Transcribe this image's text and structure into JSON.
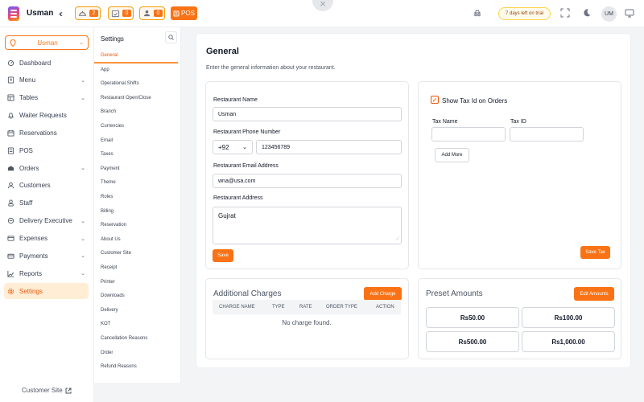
{
  "topbar": {
    "brand": "Usman",
    "chips": [
      {
        "icon": "food-tray-icon",
        "count": "2"
      },
      {
        "icon": "calendar-check-icon",
        "count": "0"
      },
      {
        "icon": "waiter-icon",
        "count": "0"
      }
    ],
    "pos_label": "POS",
    "trial_text": "7 days left on trial",
    "avatar_initials": "UM"
  },
  "sidebar": {
    "branch": "Usman",
    "items": [
      {
        "label": "Dashboard",
        "icon": "dashboard-icon",
        "chevron": false
      },
      {
        "label": "Menu",
        "icon": "menu-book-icon",
        "chevron": true
      },
      {
        "label": "Tables",
        "icon": "table-icon",
        "chevron": true
      },
      {
        "label": "Waiter Requests",
        "icon": "bell-icon",
        "chevron": false
      },
      {
        "label": "Reservations",
        "icon": "calendar-icon",
        "chevron": false
      },
      {
        "label": "POS",
        "icon": "pos-icon",
        "chevron": false
      },
      {
        "label": "Orders",
        "icon": "orders-icon",
        "chevron": true
      },
      {
        "label": "Customers",
        "icon": "customers-icon",
        "chevron": false
      },
      {
        "label": "Staff",
        "icon": "staff-icon",
        "chevron": false
      },
      {
        "label": "Delivery Executive",
        "icon": "delivery-icon",
        "chevron": true
      },
      {
        "label": "Expenses",
        "icon": "expenses-icon",
        "chevron": true
      },
      {
        "label": "Payments",
        "icon": "payments-icon",
        "chevron": true
      },
      {
        "label": "Reports",
        "icon": "reports-icon",
        "chevron": true
      },
      {
        "label": "Settings",
        "icon": "gear-icon",
        "chevron": false,
        "active": true
      }
    ],
    "customer_site": "Customer Site"
  },
  "settings_nav": {
    "title": "Settings",
    "items": [
      "General",
      "App",
      "Operational Shifts",
      "Restaurant Open/Close",
      "Branch",
      "Currencies",
      "Email",
      "Taxes",
      "Payment",
      "Theme",
      "Roles",
      "Billing",
      "Reservation",
      "About Us",
      "Customer Site",
      "Receipt",
      "Printer",
      "Downloads",
      "Delivery",
      "KOT",
      "Cancellation Reasons",
      "Order",
      "Refund Reasons"
    ],
    "active_index": 0
  },
  "general": {
    "title": "General",
    "description": "Enter the general information about your restaurant.",
    "name_label": "Restaurant Name",
    "name_value": "Usman",
    "phone_label": "Restaurant Phone Number",
    "phone_code": "+92",
    "phone_value": "123456789",
    "email_label": "Restaurant Email Address",
    "email_value": "wna@usa.com",
    "address_label": "Restaurant Address",
    "address_value": "Gujrat",
    "save_label": "Save"
  },
  "tax": {
    "show_tax_label": "Show Tax Id on Orders",
    "tax_name_label": "Tax Name",
    "tax_id_label": "Tax ID",
    "add_more_label": "Add More",
    "save_tax_label": "Save Tax"
  },
  "charges": {
    "title": "Additional Charges",
    "add_label": "Add Charge",
    "columns": [
      "CHARGE NAME",
      "TYPE",
      "RATE",
      "ORDER TYPE",
      "ACTION"
    ],
    "empty_text": "No charge found."
  },
  "presets": {
    "title": "Preset Amounts",
    "edit_label": "Edit Amounts",
    "amounts": [
      "Rs50.00",
      "Rs100.00",
      "Rs500.00",
      "Rs1,000.00"
    ]
  },
  "colors": {
    "accent": "#f97316",
    "accent_light": "#ffedd5",
    "background": "#f3f4f6"
  }
}
